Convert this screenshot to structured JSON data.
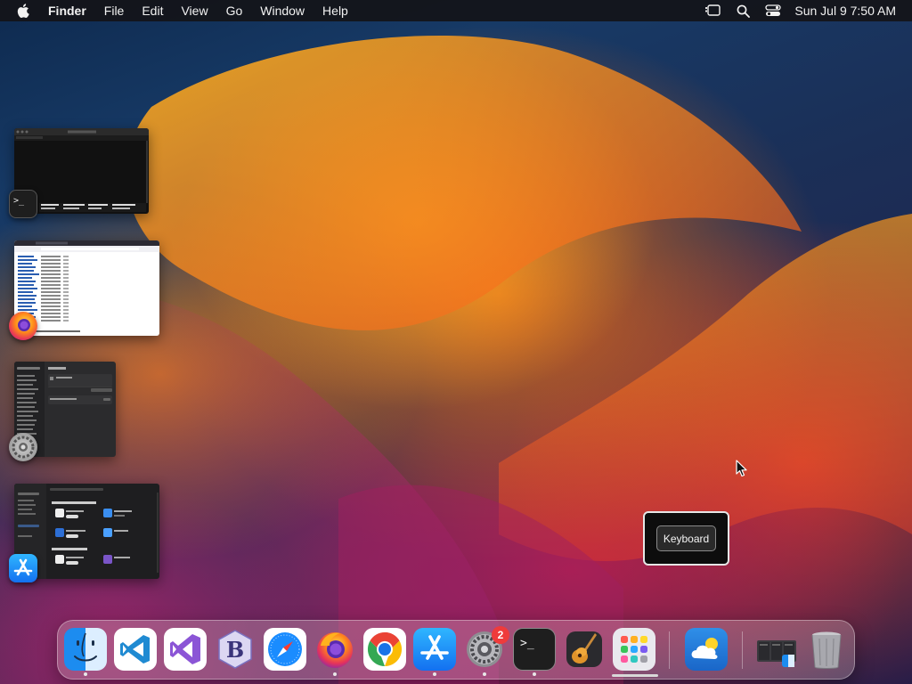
{
  "menubar": {
    "apple_icon": "apple-logo-icon",
    "app_name": "Finder",
    "items": [
      "File",
      "Edit",
      "View",
      "Go",
      "Window"
    ],
    "help": "Help",
    "status_icons": [
      "stage-manager-icon",
      "spotlight-search-icon",
      "control-center-icon"
    ],
    "clock": "Sun Jul 9  7:50 AM"
  },
  "stage_manager": {
    "groups": [
      {
        "app": "Terminal",
        "icon": "terminal-icon"
      },
      {
        "app": "Firefox",
        "icon": "firefox-icon"
      },
      {
        "app": "System Settings",
        "icon": "system-settings-icon"
      },
      {
        "app": "App Store",
        "icon": "app-store-icon"
      }
    ]
  },
  "tooltip": {
    "label": "Keyboard"
  },
  "dock": {
    "apps": [
      {
        "name": "Finder",
        "icon": "finder-icon",
        "running": true
      },
      {
        "name": "Visual Studio Code",
        "icon": "vscode-icon",
        "running": false
      },
      {
        "name": "Visual Studio",
        "icon": "visual-studio-icon",
        "running": false
      },
      {
        "name": "BBEdit",
        "icon": "bbedit-icon",
        "running": false
      },
      {
        "name": "Safari",
        "icon": "safari-icon",
        "running": false
      },
      {
        "name": "Firefox",
        "icon": "firefox-icon",
        "running": true
      },
      {
        "name": "Google Chrome",
        "icon": "chrome-icon",
        "running": false
      },
      {
        "name": "App Store",
        "icon": "app-store-icon",
        "running": true
      },
      {
        "name": "System Settings",
        "icon": "system-settings-icon",
        "running": true,
        "badge": "2"
      },
      {
        "name": "Terminal",
        "icon": "terminal-icon",
        "running": true
      },
      {
        "name": "GarageBand",
        "icon": "garageband-icon",
        "running": false
      },
      {
        "name": "Launchpad",
        "icon": "launchpad-icon",
        "running": false
      },
      {
        "name": "Weather",
        "icon": "weather-icon",
        "running": false
      },
      {
        "name": "Downloads",
        "icon": "downloads-stack-icon",
        "running": false
      },
      {
        "name": "Trash",
        "icon": "trash-icon",
        "running": false
      }
    ]
  },
  "colors": {
    "menubar_bg": "#141418",
    "badge": "#ef3b3b",
    "accent_blue": "#1a8cff"
  }
}
